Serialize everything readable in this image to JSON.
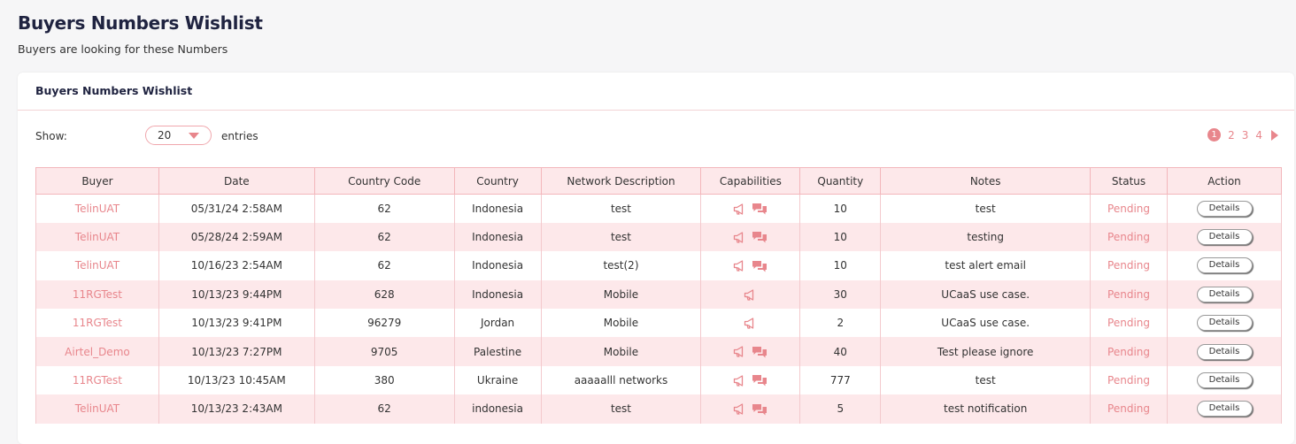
{
  "page": {
    "title": "Buyers Numbers Wishlist",
    "subtitle": "Buyers are looking for these Numbers"
  },
  "card": {
    "title": "Buyers Numbers Wishlist",
    "show_label": "Show:",
    "entries_value": "20",
    "entries_label": "entries"
  },
  "pagination": {
    "pages": [
      "1",
      "2",
      "3",
      "4"
    ],
    "current": "1"
  },
  "table": {
    "columns": [
      "Buyer",
      "Date",
      "Country Code",
      "Country",
      "Network Description",
      "Capabilities",
      "Quantity",
      "Notes",
      "Status",
      "Action"
    ],
    "rows": [
      {
        "buyer": "TelinUAT",
        "date": "05/31/24 2:58AM",
        "code": "62",
        "country": "Indonesia",
        "network": "test",
        "caps": [
          "megaphone-icon",
          "chat-icon"
        ],
        "qty": "10",
        "notes": "test",
        "status": "Pending",
        "action": "Details"
      },
      {
        "buyer": "TelinUAT",
        "date": "05/28/24 2:59AM",
        "code": "62",
        "country": "Indonesia",
        "network": "test",
        "caps": [
          "megaphone-icon",
          "chat-icon"
        ],
        "qty": "10",
        "notes": "testing",
        "status": "Pending",
        "action": "Details"
      },
      {
        "buyer": "TelinUAT",
        "date": "10/16/23 2:54AM",
        "code": "62",
        "country": "Indonesia",
        "network": "test(2)",
        "caps": [
          "megaphone-icon",
          "chat-icon"
        ],
        "qty": "10",
        "notes": "test alert email",
        "status": "Pending",
        "action": "Details"
      },
      {
        "buyer": "11RGTest",
        "date": "10/13/23 9:44PM",
        "code": "628",
        "country": "Indonesia",
        "network": "Mobile",
        "caps": [
          "megaphone-icon"
        ],
        "qty": "30",
        "notes": "UCaaS use case.",
        "status": "Pending",
        "action": "Details"
      },
      {
        "buyer": "11RGTest",
        "date": "10/13/23 9:41PM",
        "code": "96279",
        "country": "Jordan",
        "network": "Mobile",
        "caps": [
          "megaphone-icon"
        ],
        "qty": "2",
        "notes": "UCaaS use case.",
        "status": "Pending",
        "action": "Details"
      },
      {
        "buyer": "Airtel_Demo",
        "date": "10/13/23 7:27PM",
        "code": "9705",
        "country": "Palestine",
        "network": "Mobile",
        "caps": [
          "megaphone-icon",
          "chat-icon"
        ],
        "qty": "40",
        "notes": "Test please ignore",
        "status": "Pending",
        "action": "Details"
      },
      {
        "buyer": "11RGTest",
        "date": "10/13/23 10:45AM",
        "code": "380",
        "country": "Ukraine",
        "network": "aaaaalll networks",
        "caps": [
          "megaphone-icon",
          "chat-icon"
        ],
        "qty": "777",
        "notes": "test",
        "status": "Pending",
        "action": "Details"
      },
      {
        "buyer": "TelinUAT",
        "date": "10/13/23 2:43AM",
        "code": "62",
        "country": "indonesia",
        "network": "test",
        "caps": [
          "megaphone-icon",
          "chat-icon"
        ],
        "qty": "5",
        "notes": "test notification",
        "status": "Pending",
        "action": "Details"
      }
    ]
  },
  "colors": {
    "accent": "#e8868c",
    "row_alt": "#fde8ea",
    "title": "#1f2340"
  }
}
